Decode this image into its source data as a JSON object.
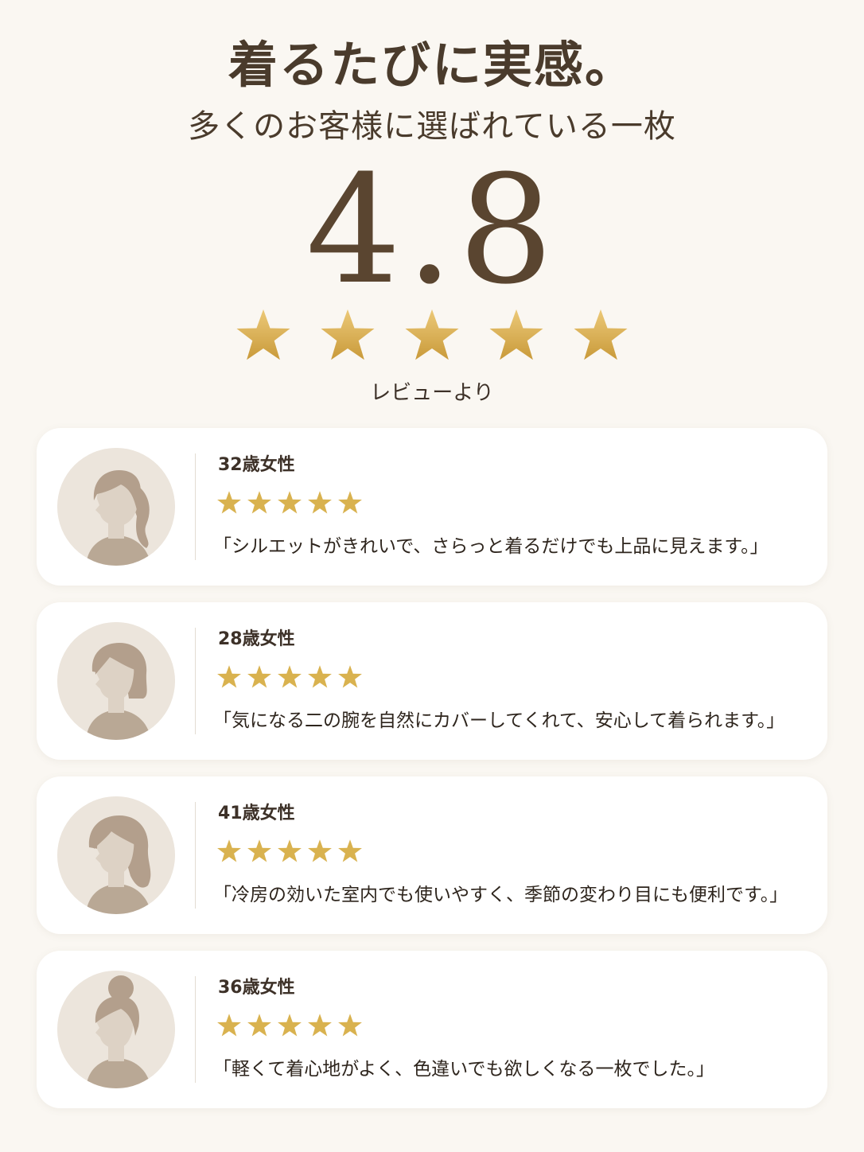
{
  "header": {
    "headline": "着るたびに実感。",
    "subheadline": "多くのお客様に選ばれている一枚",
    "rating": "4.8",
    "rating_stars": 5,
    "source": "レビューより"
  },
  "colors": {
    "background": "#faf7f2",
    "star_gold": "#d9b24f",
    "text_brown": "#4a3b2c",
    "card": "#ffffff"
  },
  "reviews": [
    {
      "reviewer": "32歳女性",
      "stars": 5,
      "comment": "「シルエットがきれいで、さらっと着るだけでも上品に見えます。」",
      "avatar_icon": "woman-ponytail-avatar-icon"
    },
    {
      "reviewer": "28歳女性",
      "stars": 5,
      "comment": "「気になる二の腕を自然にカバーしてくれて、安心して着られます。」",
      "avatar_icon": "woman-bob-avatar-icon"
    },
    {
      "reviewer": "41歳女性",
      "stars": 5,
      "comment": "「冷房の効いた室内でも使いやすく、季節の変わり目にも便利です。」",
      "avatar_icon": "woman-wavy-hair-avatar-icon"
    },
    {
      "reviewer": "36歳女性",
      "stars": 5,
      "comment": "「軽くて着心地がよく、色違いでも欲しくなる一枚でした。」",
      "avatar_icon": "woman-bun-avatar-icon"
    }
  ]
}
